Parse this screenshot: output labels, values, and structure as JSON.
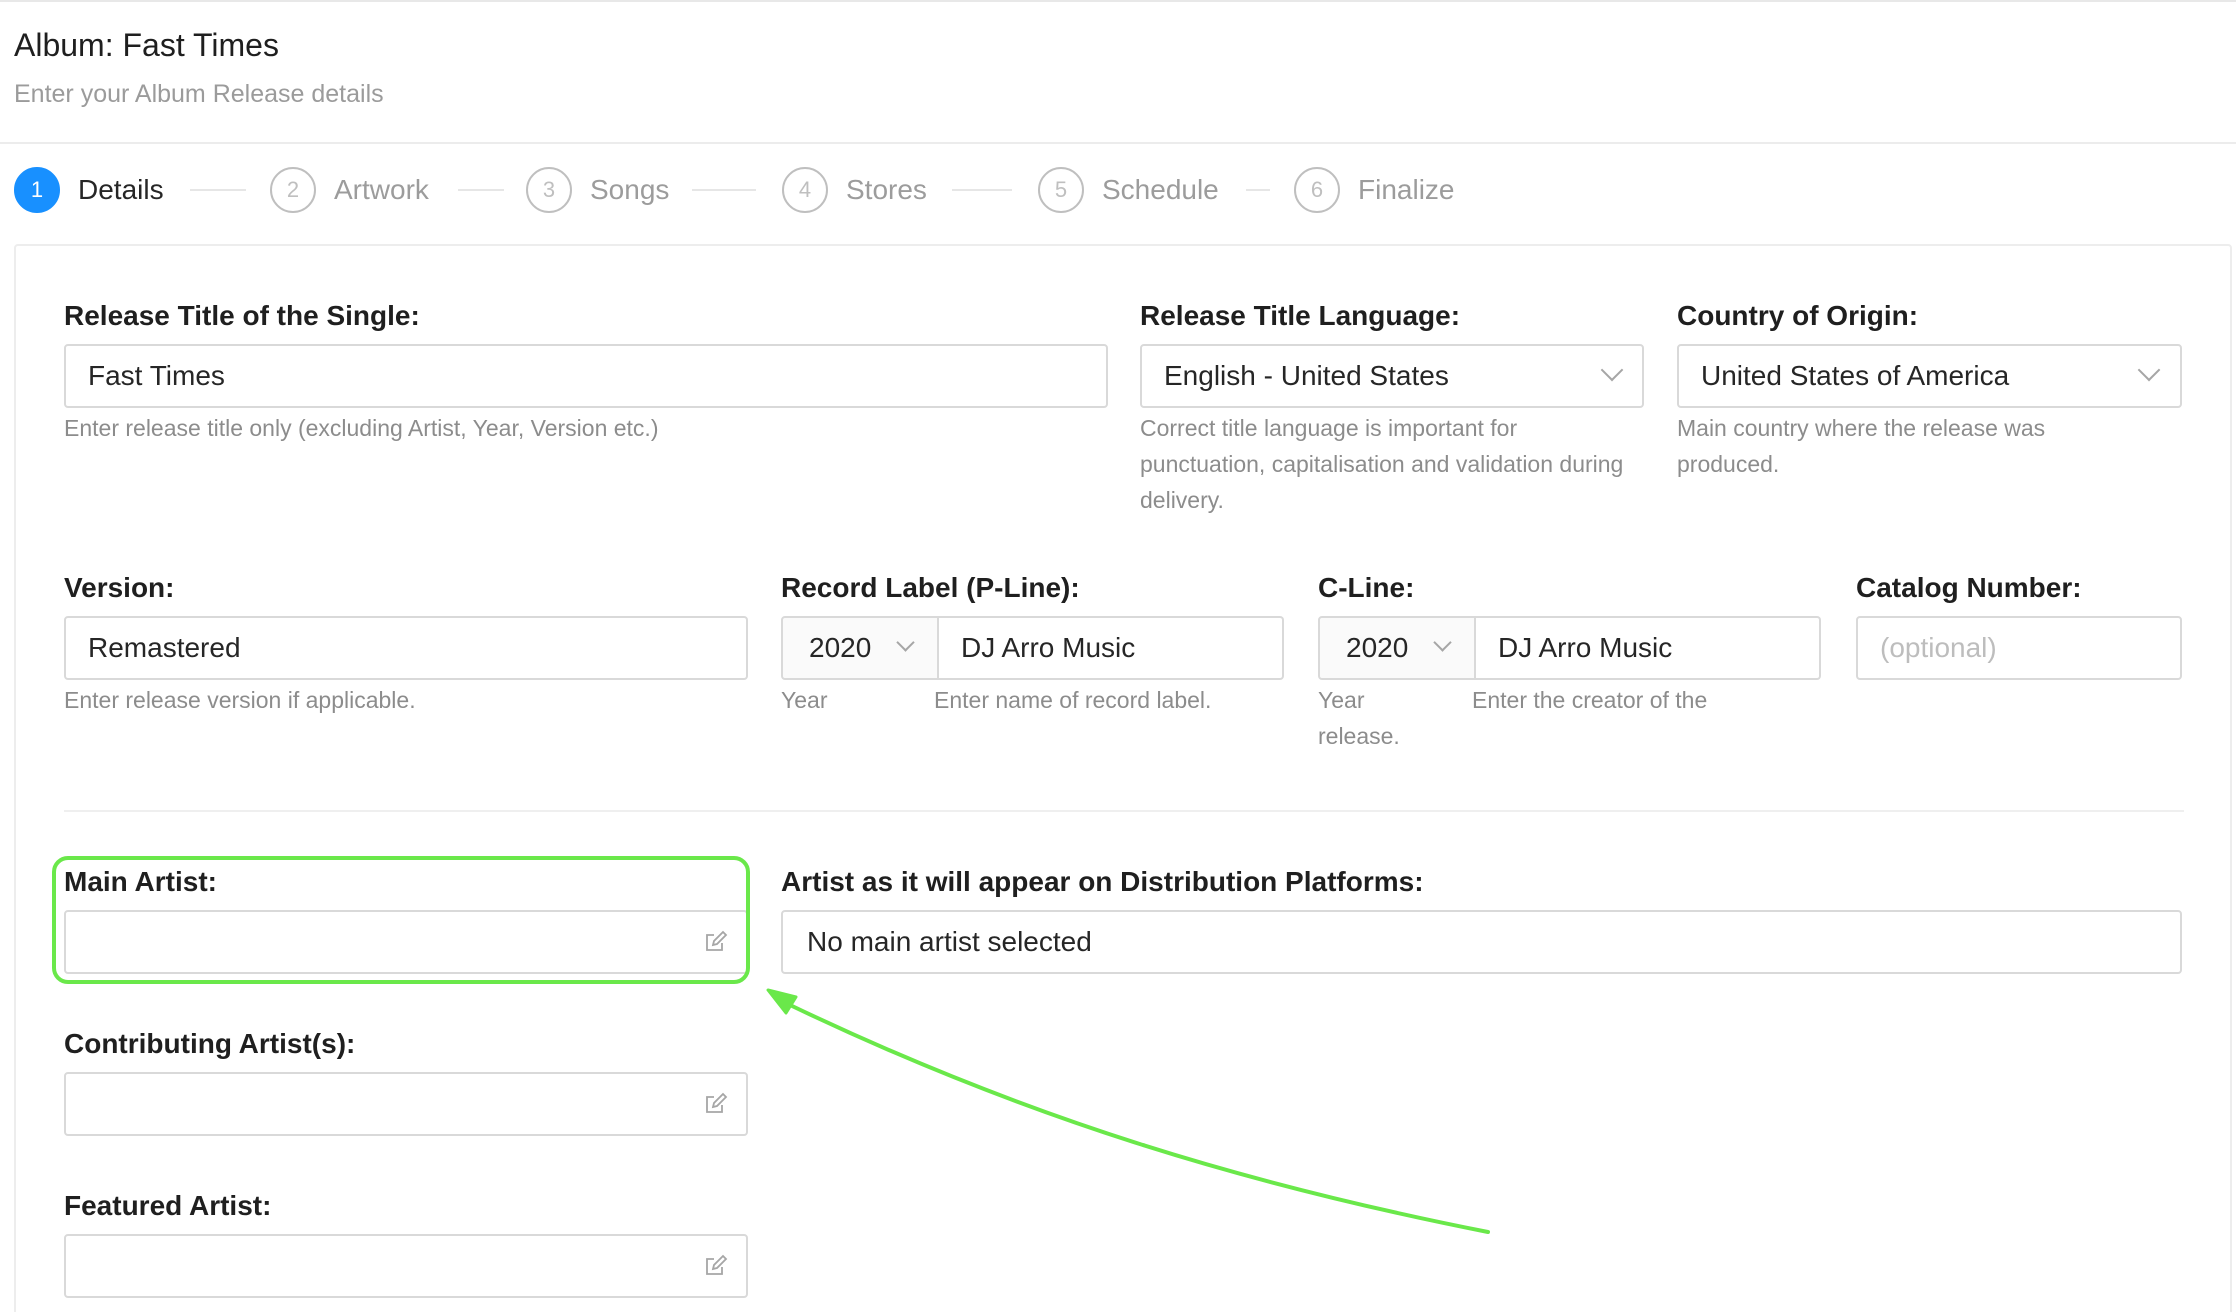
{
  "header": {
    "title": "Album: Fast Times",
    "subtitle": "Enter your Album Release details"
  },
  "steps": [
    {
      "number": "1",
      "label": "Details",
      "active": true
    },
    {
      "number": "2",
      "label": "Artwork",
      "active": false
    },
    {
      "number": "3",
      "label": "Songs",
      "active": false
    },
    {
      "number": "4",
      "label": "Stores",
      "active": false
    },
    {
      "number": "5",
      "label": "Schedule",
      "active": false
    },
    {
      "number": "6",
      "label": "Finalize",
      "active": false
    }
  ],
  "form": {
    "release_title": {
      "label": "Release Title of the Single:",
      "value": "Fast Times",
      "help": "Enter release title only (excluding Artist, Year, Version etc.)"
    },
    "title_language": {
      "label": "Release Title Language:",
      "value": "English - United States",
      "help": "Correct title language is important for punctuation, capitalisation and validation during delivery."
    },
    "country": {
      "label": "Country of Origin:",
      "value": "United States of America",
      "help": "Main country where the release was produced."
    },
    "version": {
      "label": "Version:",
      "value": "Remastered",
      "help": "Enter release version if applicable."
    },
    "record_label": {
      "label": "Record Label (P-Line):",
      "year": "2020",
      "value": "DJ Arro Music",
      "year_help": "Year",
      "help": "Enter name of record label."
    },
    "c_line": {
      "label": "C-Line:",
      "year": "2020",
      "value": "DJ Arro Music",
      "year_help": "Year",
      "help_line1": "Enter the creator of the",
      "help_line2": "release."
    },
    "catalog": {
      "label": "Catalog Number:",
      "placeholder": "(optional)"
    },
    "main_artist": {
      "label": "Main Artist:",
      "value": ""
    },
    "artist_display": {
      "label": "Artist as it will appear on Distribution Platforms:",
      "value": "No main artist selected"
    },
    "contributing": {
      "label": "Contributing Artist(s):",
      "value": ""
    },
    "featured": {
      "label": "Featured Artist:",
      "value": ""
    }
  },
  "colors": {
    "accent": "#1890ff",
    "highlight": "#6ae84a"
  }
}
